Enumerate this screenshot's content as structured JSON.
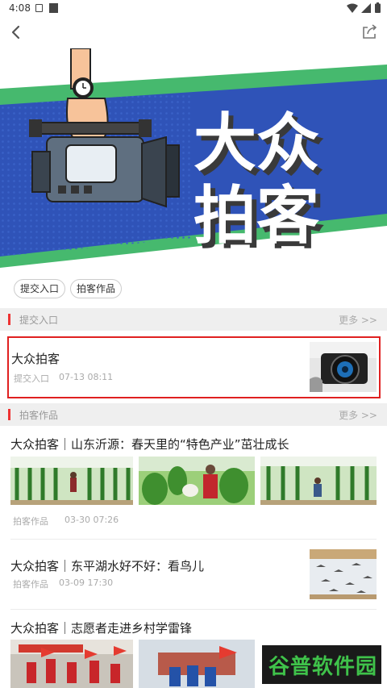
{
  "status": {
    "time": "4:08"
  },
  "banner": {
    "title_line1": "大众",
    "title_line2": "拍客"
  },
  "tags": [
    "提交入口",
    "拍客作品"
  ],
  "sections": {
    "submit": {
      "title": "提交入口",
      "more": "更多 >>"
    },
    "works": {
      "title": "拍客作品",
      "more": "更多 >>"
    }
  },
  "featured": {
    "title": "大众拍客",
    "category": "提交入口",
    "date": "07-13 08:11"
  },
  "articles": [
    {
      "title": "大众拍客｜山东沂源：春天里的“特色产业”茁壮成长",
      "category": "拍客作品",
      "date": "03-30 07:26"
    },
    {
      "title": "大众拍客｜东平湖水好不好：看鸟儿",
      "category": "拍客作品",
      "date": "03-09 17:30"
    },
    {
      "title": "大众拍客｜志愿者走进乡村学雷锋"
    }
  ],
  "watermark": {
    "text": "谷普软件园"
  }
}
